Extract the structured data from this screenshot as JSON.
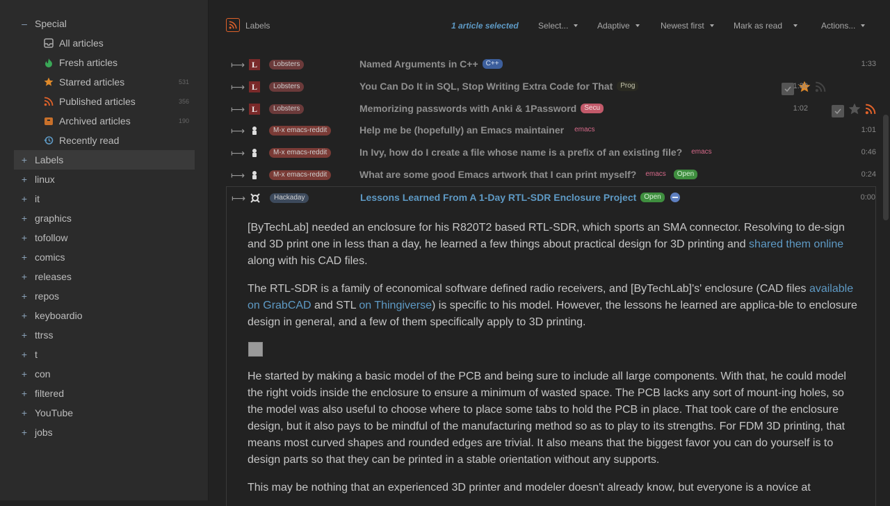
{
  "sidebar": {
    "special": {
      "toggle": "–",
      "label": "Special"
    },
    "feeds": [
      {
        "label": "All articles",
        "count": "",
        "icon": "inbox-icon"
      },
      {
        "label": "Fresh articles",
        "count": "",
        "icon": "fresh-icon"
      },
      {
        "label": "Starred articles",
        "count": "531",
        "icon": "star-icon"
      },
      {
        "label": "Published articles",
        "count": "356",
        "icon": "rss-icon"
      },
      {
        "label": "Archived articles",
        "count": "190",
        "icon": "archive-icon"
      },
      {
        "label": "Recently read",
        "count": "",
        "icon": "history-icon"
      }
    ],
    "categories": [
      {
        "toggle": "+",
        "label": "Labels"
      },
      {
        "toggle": "+",
        "label": "linux"
      },
      {
        "toggle": "+",
        "label": "it"
      },
      {
        "toggle": "+",
        "label": "graphics"
      },
      {
        "toggle": "+",
        "label": "tofollow"
      },
      {
        "toggle": "+",
        "label": "comics"
      },
      {
        "toggle": "+",
        "label": "releases"
      },
      {
        "toggle": "+",
        "label": "repos"
      },
      {
        "toggle": "+",
        "label": "keyboardio"
      },
      {
        "toggle": "+",
        "label": "ttrss"
      },
      {
        "toggle": "+",
        "label": "t"
      },
      {
        "toggle": "+",
        "label": "con"
      },
      {
        "toggle": "+",
        "label": "filtered"
      },
      {
        "toggle": "+",
        "label": "YouTube"
      },
      {
        "toggle": "+",
        "label": "jobs"
      }
    ]
  },
  "toolbar": {
    "feed_title": "Labels",
    "selection": "1 article selected",
    "select": "Select...",
    "view_mode": "Adaptive",
    "sort": "Newest first",
    "mark_read": "Mark as read",
    "actions": "Actions..."
  },
  "headlines": [
    {
      "feed": "Lobsters",
      "title": "Named Arguments in C++",
      "tags": [
        {
          "text": "C++",
          "bg": "#3d5f9c",
          "fg": "#d6e0f0"
        }
      ],
      "time": "1:33"
    },
    {
      "feed": "Lobsters",
      "title": "You Can Do It in SQL, Stop Writing Extra Code for That",
      "tags": [
        {
          "text": "Prog",
          "bg": "#2a2a22",
          "fg": "#c8c8b0"
        }
      ],
      "time": "1:30"
    },
    {
      "feed": "Lobsters",
      "title": "Memorizing passwords with Anki & 1Password",
      "tags": [
        {
          "text": "Secu",
          "bg": "#c25a6a",
          "fg": "#f3dede"
        }
      ],
      "time": "1:02"
    },
    {
      "feed": "M-x emacs-reddit",
      "title": "Help me be (hopefully) an Emacs maintainer",
      "tags": [
        {
          "text": "emacs",
          "bg": "transparent",
          "fg": "#d76a8a"
        }
      ],
      "time": "1:01"
    },
    {
      "feed": "M-x emacs-reddit",
      "title": "In Ivy, how do I create a file whose name is a prefix of an existing file?",
      "tags": [
        {
          "text": "emacs",
          "bg": "transparent",
          "fg": "#d76a8a"
        }
      ],
      "time": "0:46"
    },
    {
      "feed": "M-x emacs-reddit",
      "title": "What are some good Emacs artwork that I can print myself?",
      "tags": [
        {
          "text": "emacs",
          "bg": "transparent",
          "fg": "#d76a8a"
        },
        {
          "text": "Open",
          "bg": "#3f8f3f",
          "fg": "#d6f0d6"
        }
      ],
      "time": "0:24"
    },
    {
      "feed": "Hackaday",
      "title": "Lessons Learned From A 1-Day RTL-SDR Enclosure Project",
      "tags": [
        {
          "text": "Open",
          "bg": "#3f8f3f",
          "fg": "#d6f0d6"
        }
      ],
      "time": "0:00"
    }
  ],
  "article": {
    "p1_a": "[ByTechLab] needed an enclosure for his R820T2 based RTL-SDR, which sports an SMA connector. Resolving to de-sign and 3D print one in less than a day, he learned a few things about practical design for 3D printing and ",
    "p1_link": "shared them online",
    "p1_b": " along with his CAD files.",
    "p2_a": "The RTL-SDR is a family of economical software defined radio receivers, and [ByTechLab]'s' enclosure (CAD files ",
    "p2_link1": "available on GrabCAD",
    "p2_mid": " and STL ",
    "p2_link2": "on Thingiverse",
    "p2_b": ") is specific to his model. However, the lessons he learned are applica-ble to enclosure design in general, and a few of them specifically apply to 3D printing.",
    "p3": "He started by making a basic model of the PCB and being sure to include all large components. With that, he could model the right voids inside the enclosure to ensure a minimum of wasted space. The PCB lacks any sort of mount-ing holes, so the model was also useful to choose where to place some tabs to hold the PCB in place. That took care of the enclosure design, but it also pays to be mindful of the manufacturing method so as to play to its strengths. For FDM 3D printing, that means most curved shapes and rounded edges are trivial. It also means that the biggest favor you can do yourself is to design parts so that they can be printed in a stable orientation without any supports.",
    "p4": "This may be nothing that an experienced 3D printer and modeler doesn't already know, but everyone is a novice at"
  },
  "colors": {
    "accent": "#5e9ac5",
    "star": "#e08a2a",
    "rss": "#e0622a"
  }
}
